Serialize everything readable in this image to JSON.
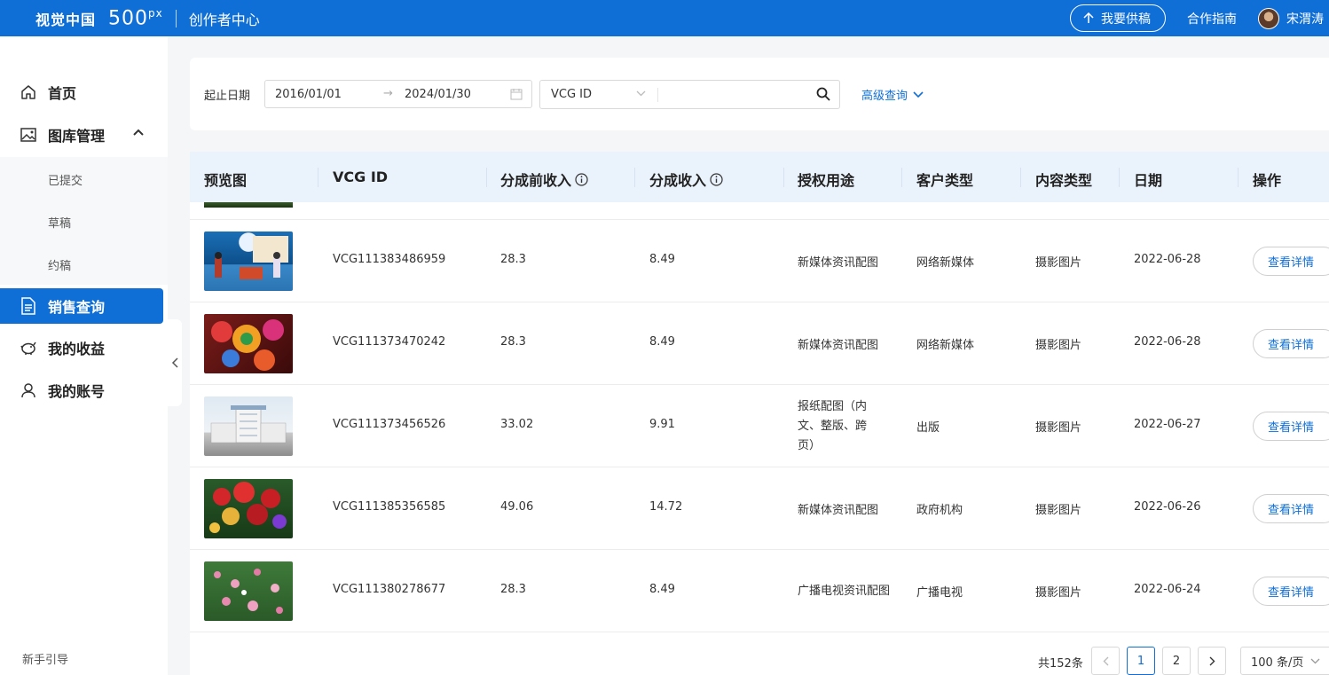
{
  "header": {
    "brand_cn": "视觉中国",
    "brand_500": "500",
    "brand_px": "px",
    "center_title": "创作者中心",
    "supply_button": "我要供稿",
    "guide_link": "合作指南",
    "user_name": "宋渭涛"
  },
  "sidebar": {
    "items": [
      {
        "label": "首页"
      },
      {
        "label": "图库管理"
      },
      {
        "label": "销售查询"
      },
      {
        "label": "我的收益"
      },
      {
        "label": "我的账号"
      }
    ],
    "sub_items": [
      {
        "label": "已提交"
      },
      {
        "label": "草稿"
      },
      {
        "label": "约稿"
      }
    ],
    "newbie_guide": "新手引导"
  },
  "filter": {
    "date_label": "起止日期",
    "date_start": "2016/01/01",
    "date_end": "2024/01/30",
    "search_type": "VCG ID",
    "search_value": "",
    "advanced_query": "高级查询"
  },
  "table": {
    "columns": [
      "预览图",
      "VCG ID",
      "分成前收入",
      "分成收入",
      "授权用途",
      "客户类型",
      "内容类型",
      "日期",
      "操作"
    ],
    "detail_label": "查看详情",
    "rows": [
      {
        "vcg_id": "VCG111383486959",
        "pre_income": "28.3",
        "income": "8.49",
        "usage": "新媒体资讯配图",
        "client": "网络新媒体",
        "content": "摄影图片",
        "date": "2022-06-28"
      },
      {
        "vcg_id": "VCG111373470242",
        "pre_income": "28.3",
        "income": "8.49",
        "usage": "新媒体资讯配图",
        "client": "网络新媒体",
        "content": "摄影图片",
        "date": "2022-06-28"
      },
      {
        "vcg_id": "VCG111373456526",
        "pre_income": "33.02",
        "income": "9.91",
        "usage": "报纸配图（内文、整版、跨页）",
        "client": "出版",
        "content": "摄影图片",
        "date": "2022-06-27"
      },
      {
        "vcg_id": "VCG111385356585",
        "pre_income": "49.06",
        "income": "14.72",
        "usage": "新媒体资讯配图",
        "client": "政府机构",
        "content": "摄影图片",
        "date": "2022-06-26"
      },
      {
        "vcg_id": "VCG111380278677",
        "pre_income": "28.3",
        "income": "8.49",
        "usage": "广播电视资讯配图",
        "client": "广播电视",
        "content": "摄影图片",
        "date": "2022-06-24"
      }
    ]
  },
  "pagination": {
    "total": "共152条",
    "pages": [
      "1",
      "2"
    ],
    "current_page": "1",
    "page_size": "100 条/页"
  },
  "colors": {
    "brand_blue": "#0f6fd6",
    "header_row_bg": "#eaf2fc"
  }
}
